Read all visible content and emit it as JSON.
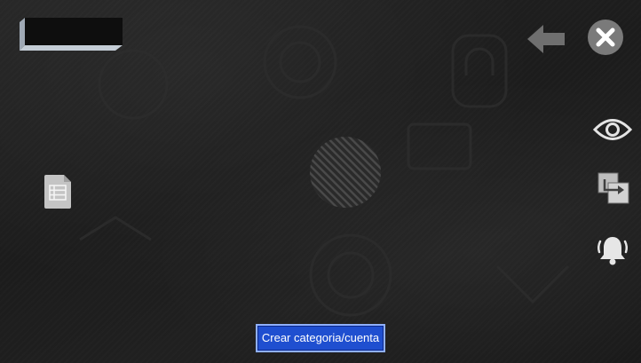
{
  "buttons": {
    "create_label": "Crear categoria/cuenta"
  },
  "icons": {
    "back": "arrow-left-icon",
    "close": "close-icon",
    "view": "eye-icon",
    "transfer": "transfer-icon",
    "alerts": "bell-icon",
    "list": "document-list-icon",
    "logo": "logo-placeholder",
    "center": "striped-circle-icon"
  },
  "colors": {
    "background": "#1c1c1c",
    "button_bg": "#1f4fd0",
    "button_border": "#8fb0ff",
    "icon": "#d0d0d0"
  }
}
